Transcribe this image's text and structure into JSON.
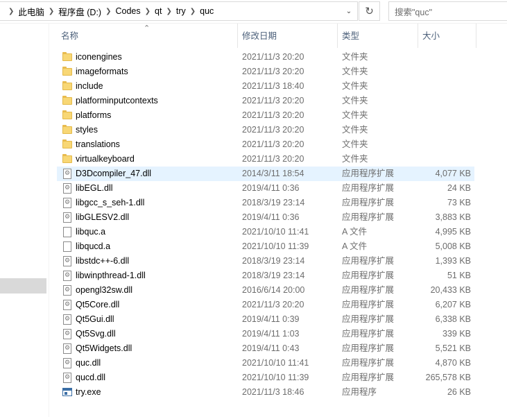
{
  "address": {
    "breadcrumbs": [
      "此电脑",
      "程序盘 (D:)",
      "Codes",
      "qt",
      "try",
      "quc"
    ],
    "search_placeholder": "搜索\"quc\""
  },
  "columns": {
    "name": "名称",
    "date": "修改日期",
    "type": "类型",
    "size": "大小"
  },
  "files": [
    {
      "name": "iconengines",
      "date": "2021/11/3 20:20",
      "type": "文件夹",
      "size": "",
      "icon": "folder"
    },
    {
      "name": "imageformats",
      "date": "2021/11/3 20:20",
      "type": "文件夹",
      "size": "",
      "icon": "folder"
    },
    {
      "name": "include",
      "date": "2021/11/3 18:40",
      "type": "文件夹",
      "size": "",
      "icon": "folder"
    },
    {
      "name": "platforminputcontexts",
      "date": "2021/11/3 20:20",
      "type": "文件夹",
      "size": "",
      "icon": "folder"
    },
    {
      "name": "platforms",
      "date": "2021/11/3 20:20",
      "type": "文件夹",
      "size": "",
      "icon": "folder"
    },
    {
      "name": "styles",
      "date": "2021/11/3 20:20",
      "type": "文件夹",
      "size": "",
      "icon": "folder"
    },
    {
      "name": "translations",
      "date": "2021/11/3 20:20",
      "type": "文件夹",
      "size": "",
      "icon": "folder"
    },
    {
      "name": "virtualkeyboard",
      "date": "2021/11/3 20:20",
      "type": "文件夹",
      "size": "",
      "icon": "folder"
    },
    {
      "name": "D3Dcompiler_47.dll",
      "date": "2014/3/11 18:54",
      "type": "应用程序扩展",
      "size": "4,077 KB",
      "icon": "dll",
      "selected": true
    },
    {
      "name": "libEGL.dll",
      "date": "2019/4/11 0:36",
      "type": "应用程序扩展",
      "size": "24 KB",
      "icon": "dll"
    },
    {
      "name": "libgcc_s_seh-1.dll",
      "date": "2018/3/19 23:14",
      "type": "应用程序扩展",
      "size": "73 KB",
      "icon": "dll"
    },
    {
      "name": "libGLESV2.dll",
      "date": "2019/4/11 0:36",
      "type": "应用程序扩展",
      "size": "3,883 KB",
      "icon": "dll"
    },
    {
      "name": "libquc.a",
      "date": "2021/10/10 11:41",
      "type": "A 文件",
      "size": "4,995 KB",
      "icon": "file"
    },
    {
      "name": "libqucd.a",
      "date": "2021/10/10 11:39",
      "type": "A 文件",
      "size": "5,008 KB",
      "icon": "file"
    },
    {
      "name": "libstdc++-6.dll",
      "date": "2018/3/19 23:14",
      "type": "应用程序扩展",
      "size": "1,393 KB",
      "icon": "dll"
    },
    {
      "name": "libwinpthread-1.dll",
      "date": "2018/3/19 23:14",
      "type": "应用程序扩展",
      "size": "51 KB",
      "icon": "dll"
    },
    {
      "name": "opengl32sw.dll",
      "date": "2016/6/14 20:00",
      "type": "应用程序扩展",
      "size": "20,433 KB",
      "icon": "dll"
    },
    {
      "name": "Qt5Core.dll",
      "date": "2021/11/3 20:20",
      "type": "应用程序扩展",
      "size": "6,207 KB",
      "icon": "dll"
    },
    {
      "name": "Qt5Gui.dll",
      "date": "2019/4/11 0:39",
      "type": "应用程序扩展",
      "size": "6,338 KB",
      "icon": "dll"
    },
    {
      "name": "Qt5Svg.dll",
      "date": "2019/4/11 1:03",
      "type": "应用程序扩展",
      "size": "339 KB",
      "icon": "dll"
    },
    {
      "name": "Qt5Widgets.dll",
      "date": "2019/4/11 0:43",
      "type": "应用程序扩展",
      "size": "5,521 KB",
      "icon": "dll"
    },
    {
      "name": "quc.dll",
      "date": "2021/10/10 11:41",
      "type": "应用程序扩展",
      "size": "4,870 KB",
      "icon": "dll"
    },
    {
      "name": "qucd.dll",
      "date": "2021/10/10 11:39",
      "type": "应用程序扩展",
      "size": "265,578 KB",
      "icon": "dll"
    },
    {
      "name": "try.exe",
      "date": "2021/11/3 18:46",
      "type": "应用程序",
      "size": "26 KB",
      "icon": "exe"
    }
  ]
}
